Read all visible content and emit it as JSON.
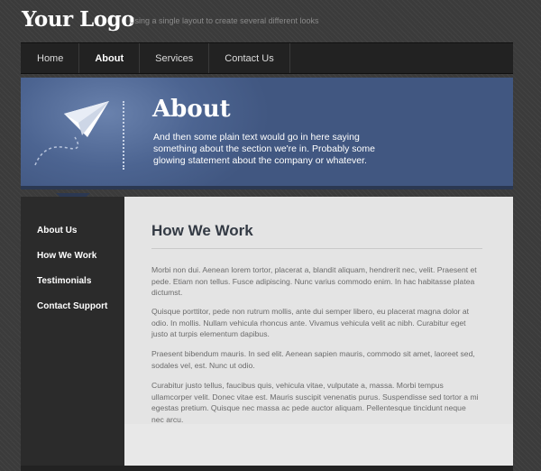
{
  "header": {
    "logo": "Your Logo",
    "tagline": "Using a single layout to create several different looks"
  },
  "nav": {
    "items": [
      {
        "label": "Home"
      },
      {
        "label": "About",
        "active": true
      },
      {
        "label": "Services"
      },
      {
        "label": "Contact Us"
      }
    ]
  },
  "hero": {
    "title": "About",
    "text": "And then some plain text would go in here saying something about the section we're in. Probably some glowing statement about the company or whatever.",
    "icon": "paper-plane-icon"
  },
  "sidebar": {
    "items": [
      {
        "label": "About Us"
      },
      {
        "label": "How We Work"
      },
      {
        "label": "Testimonials"
      },
      {
        "label": "Contact Support"
      }
    ]
  },
  "main": {
    "title": "How We Work",
    "paragraphs": [
      "Morbi non dui. Aenean lorem tortor, placerat a, blandit aliquam, hendrerit nec, velit. Praesent et pede. Etiam non tellus. Fusce adipiscing. Nunc varius commodo enim. In hac habitasse platea dictumst.",
      "Quisque porttitor, pede non rutrum mollis, ante dui semper libero, eu placerat magna dolor at odio. In mollis. Nullam vehicula rhoncus ante. Vivamus vehicula velit ac nibh. Curabitur eget justo at turpis elementum dapibus.",
      "Praesent bibendum mauris. In sed elit. Aenean sapien mauris, commodo sit amet, laoreet sed, sodales vel, est. Nunc ut odio.",
      "Curabitur justo tellus, faucibus quis, vehicula vitae, vulputate a, massa. Morbi tempus ullamcorper velit. Donec vitae est. Mauris suscipit venenatis purus. Suspendisse sed tortor a mi egestas pretium. Quisque nec massa ac pede auctor aliquam. Pellentesque tincidunt neque nec arcu."
    ]
  },
  "colors": {
    "hero_blue": "#4c6491",
    "sidebar_dark": "#2b2b2b",
    "content_bg": "#e4e4e4"
  }
}
